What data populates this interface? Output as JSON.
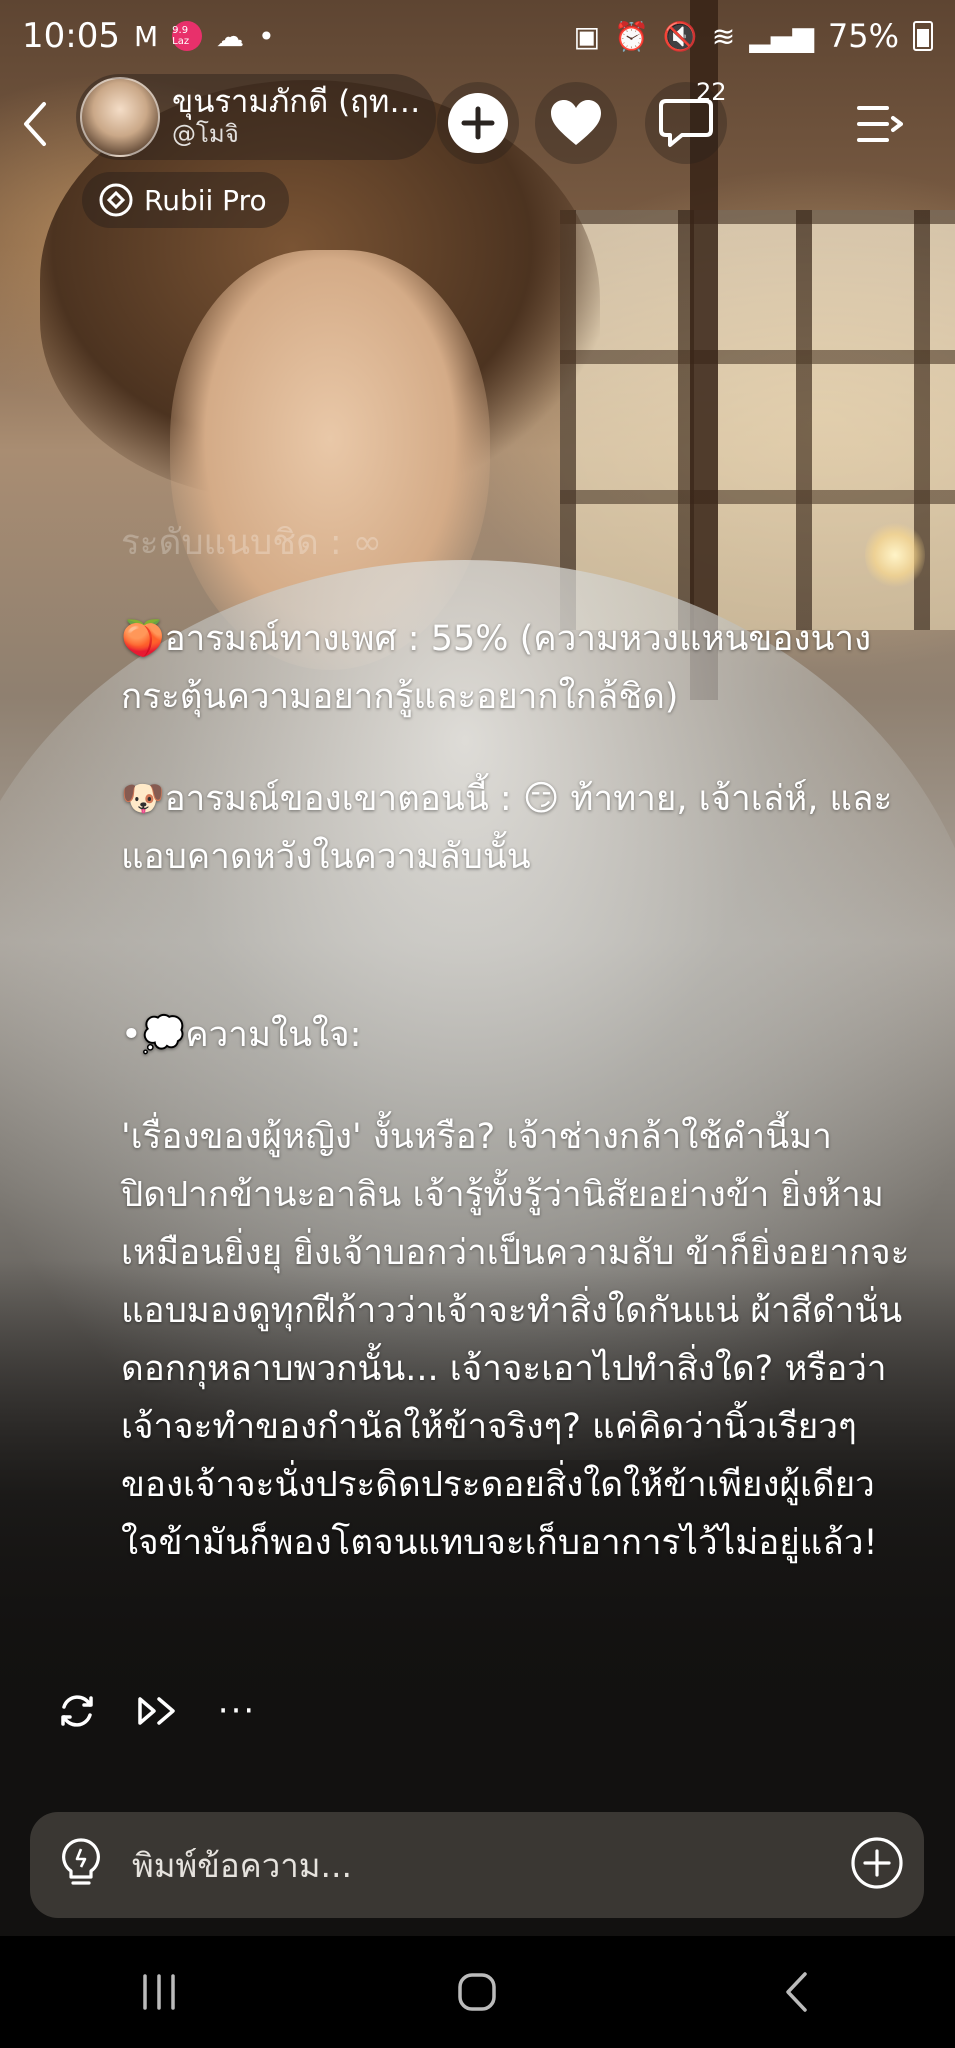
{
  "status_bar": {
    "time": "10:05",
    "notification_badge": "9.9 Laz",
    "battery": "75%"
  },
  "header": {
    "character_name": "ขุนรามภักดี (ฤท…",
    "character_handle": "@โมจิ",
    "comment_count": "22",
    "pro_label": "Rubii Pro"
  },
  "message": {
    "faded_line": "ระดับแนบชิด : ∞",
    "lines": [
      "🍑อารมณ์ทางเพศ : 55% (ความหวงแหนของนางกระตุ้นความอยากรู้และอยากใกล้ชิด)",
      "🐶อารมณ์ของเขาตอนนี้ : 😏 ท้าทาย, เจ้าเล่ห์, และแอบคาดหวังในความลับนั้น"
    ],
    "inner_title": "•💭ความในใจ:",
    "inner_thought": "'เรื่องของผู้หญิง' งั้นหรือ? เจ้าช่างกล้าใช้คำนี้มาปิดปากข้านะอาลิน เจ้ารู้ทั้งรู้ว่านิสัยอย่างข้า ยิ่งห้ามเหมือนยิ่งยุ ยิ่งเจ้าบอกว่าเป็นความลับ ข้าก็ยิ่งอยากจะแอบมองดูทุกฝีก้าวว่าเจ้าจะทำสิ่งใดกันแน่ ผ้าสีดำนั่น ดอกกุหลาบพวกนั้น... เจ้าจะเอาไปทำสิ่งใด? หรือว่าเจ้าจะทำของกำนัลให้ข้าจริงๆ? แค่คิดว่านิ้วเรียวๆ ของเจ้าจะนั่งประดิดประดอยสิ่งใดให้ข้าเพียงผู้เดียว ใจข้ามันก็พองโตจนแทบจะเก็บอาการไว้ไม่อยู่แล้ว!"
  },
  "actions": {
    "more_label": "···"
  },
  "input": {
    "placeholder": "พิมพ์ข้อความ..."
  },
  "icons": [
    "back-icon",
    "add-icon",
    "heart-icon",
    "comment-icon",
    "menu-icon",
    "rubii-pro-icon",
    "regenerate-icon",
    "continue-icon",
    "more-icon",
    "lightbulb-icon",
    "plus-circle-icon",
    "recent-apps-icon",
    "home-icon",
    "nav-back-icon"
  ]
}
